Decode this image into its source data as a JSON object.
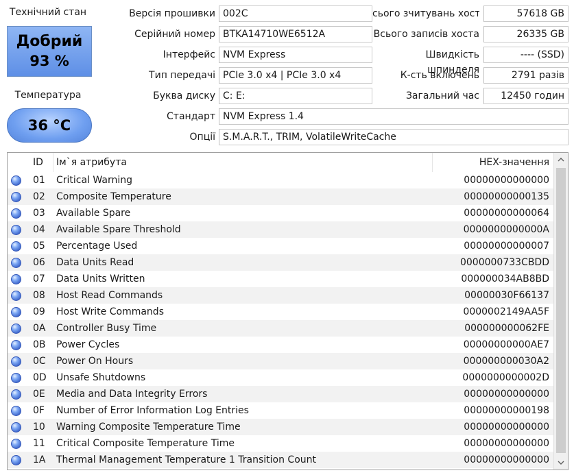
{
  "status": {
    "health_label": "Технічний стан",
    "health_status": "Добрий",
    "health_percent": "93 %",
    "temp_label": "Температура",
    "temp_value": "36 °C"
  },
  "info": {
    "firmware_label": "Версія прошивки",
    "firmware_value": "002C",
    "serial_label": "Серійний номер",
    "serial_value": "BTKA14710WE6512A",
    "interface_label": "Інтерфейс",
    "interface_value": "NVM Express",
    "transfer_label": "Тип передачі",
    "transfer_value": "PCIe 3.0 x4 | PCIe 3.0 x4",
    "drive_letter_label": "Буква диску",
    "drive_letter_value": "C: E:",
    "standard_label": "Стандарт",
    "standard_value": "NVM Express 1.4",
    "options_label": "Опції",
    "options_value": "S.M.A.R.T., TRIM, VolatileWriteCache",
    "host_reads_label": "сього зчитувань хоста",
    "host_reads_value": "57618 GB",
    "host_writes_label": "Всього записів хоста",
    "host_writes_value": "26335 GB",
    "rotation_label": "Швидкість шпинделя",
    "rotation_value": "---- (SSD)",
    "power_count_label": "К-сть включень",
    "power_count_value": "2791 разів",
    "power_hours_label": "Загальний час",
    "power_hours_value": "12450 годин"
  },
  "table": {
    "headers": {
      "id": "ID",
      "name": "Ім`я атрибута",
      "hex": "HEX-значення"
    },
    "rows": [
      {
        "id": "01",
        "name": "Critical Warning",
        "hex": "00000000000000"
      },
      {
        "id": "02",
        "name": "Composite Temperature",
        "hex": "00000000000135"
      },
      {
        "id": "03",
        "name": "Available Spare",
        "hex": "00000000000064"
      },
      {
        "id": "04",
        "name": "Available Spare Threshold",
        "hex": "0000000000000A"
      },
      {
        "id": "05",
        "name": "Percentage Used",
        "hex": "00000000000007"
      },
      {
        "id": "06",
        "name": "Data Units Read",
        "hex": "0000000733CBDD"
      },
      {
        "id": "07",
        "name": "Data Units Written",
        "hex": "000000034AB8BD"
      },
      {
        "id": "08",
        "name": "Host Read Commands",
        "hex": "00000030F66137"
      },
      {
        "id": "09",
        "name": "Host Write Commands",
        "hex": "0000002149AA5F"
      },
      {
        "id": "0A",
        "name": "Controller Busy Time",
        "hex": "000000000062FE"
      },
      {
        "id": "0B",
        "name": "Power Cycles",
        "hex": "00000000000AE7"
      },
      {
        "id": "0C",
        "name": "Power On Hours",
        "hex": "000000000030A2"
      },
      {
        "id": "0D",
        "name": "Unsafe Shutdowns",
        "hex": "0000000000002D"
      },
      {
        "id": "0E",
        "name": "Media and Data Integrity Errors",
        "hex": "00000000000000"
      },
      {
        "id": "0F",
        "name": "Number of Error Information Log Entries",
        "hex": "00000000000198"
      },
      {
        "id": "10",
        "name": "Warning Composite Temperature Time",
        "hex": "00000000000000"
      },
      {
        "id": "11",
        "name": "Critical Composite Temperature Time",
        "hex": "00000000000000"
      },
      {
        "id": "1A",
        "name": "Thermal Management Temperature 1 Transition Count",
        "hex": "00000000000000"
      }
    ]
  },
  "colors": {
    "health_blue": "#5e8fe6",
    "temp_blue": "#6f9ff0",
    "row_alt": "#f2f2f2"
  },
  "icons": {
    "row_status": "status-dot-icon",
    "scroll_up": "chevron-up-icon",
    "scroll_down": "chevron-down-icon"
  }
}
